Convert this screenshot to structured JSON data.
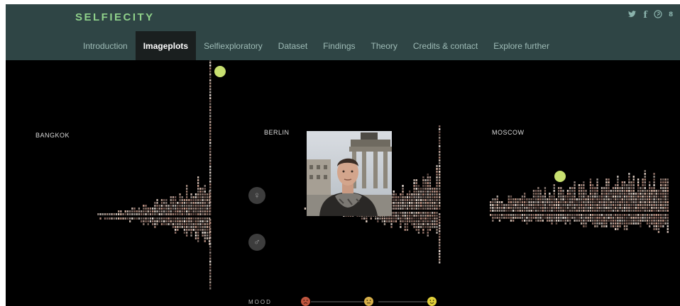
{
  "app": {
    "logo": "SELFIECITY"
  },
  "social_icons": [
    "twitter-icon",
    "facebook-icon",
    "pinterest-icon",
    "google-plus-icon"
  ],
  "nav": {
    "tabs": [
      {
        "label": "Introduction",
        "active": false
      },
      {
        "label": "Imageplots",
        "active": true
      },
      {
        "label": "Selfiexploratory",
        "active": false
      },
      {
        "label": "Dataset",
        "active": false
      },
      {
        "label": "Findings",
        "active": false
      },
      {
        "label": "Theory",
        "active": false
      },
      {
        "label": "Credits & contact",
        "active": false
      },
      {
        "label": "Explore further",
        "active": false
      }
    ]
  },
  "plots": {
    "cities": [
      {
        "label": "BANGKOK"
      },
      {
        "label": "BERLIN"
      },
      {
        "label": "MOSCOW"
      }
    ],
    "female_symbol": "♀",
    "male_symbol": "♂"
  },
  "mood": {
    "label": "MOOD",
    "levels": [
      "sad",
      "neutral",
      "happy"
    ]
  },
  "colors": {
    "header_bg": "#2f4545",
    "logo": "#8fd18a",
    "nav_text": "#9ebbb6",
    "active_tab_bg": "#1a1f1f",
    "highlight": "#c8e070",
    "stage_bg": "#000000"
  }
}
